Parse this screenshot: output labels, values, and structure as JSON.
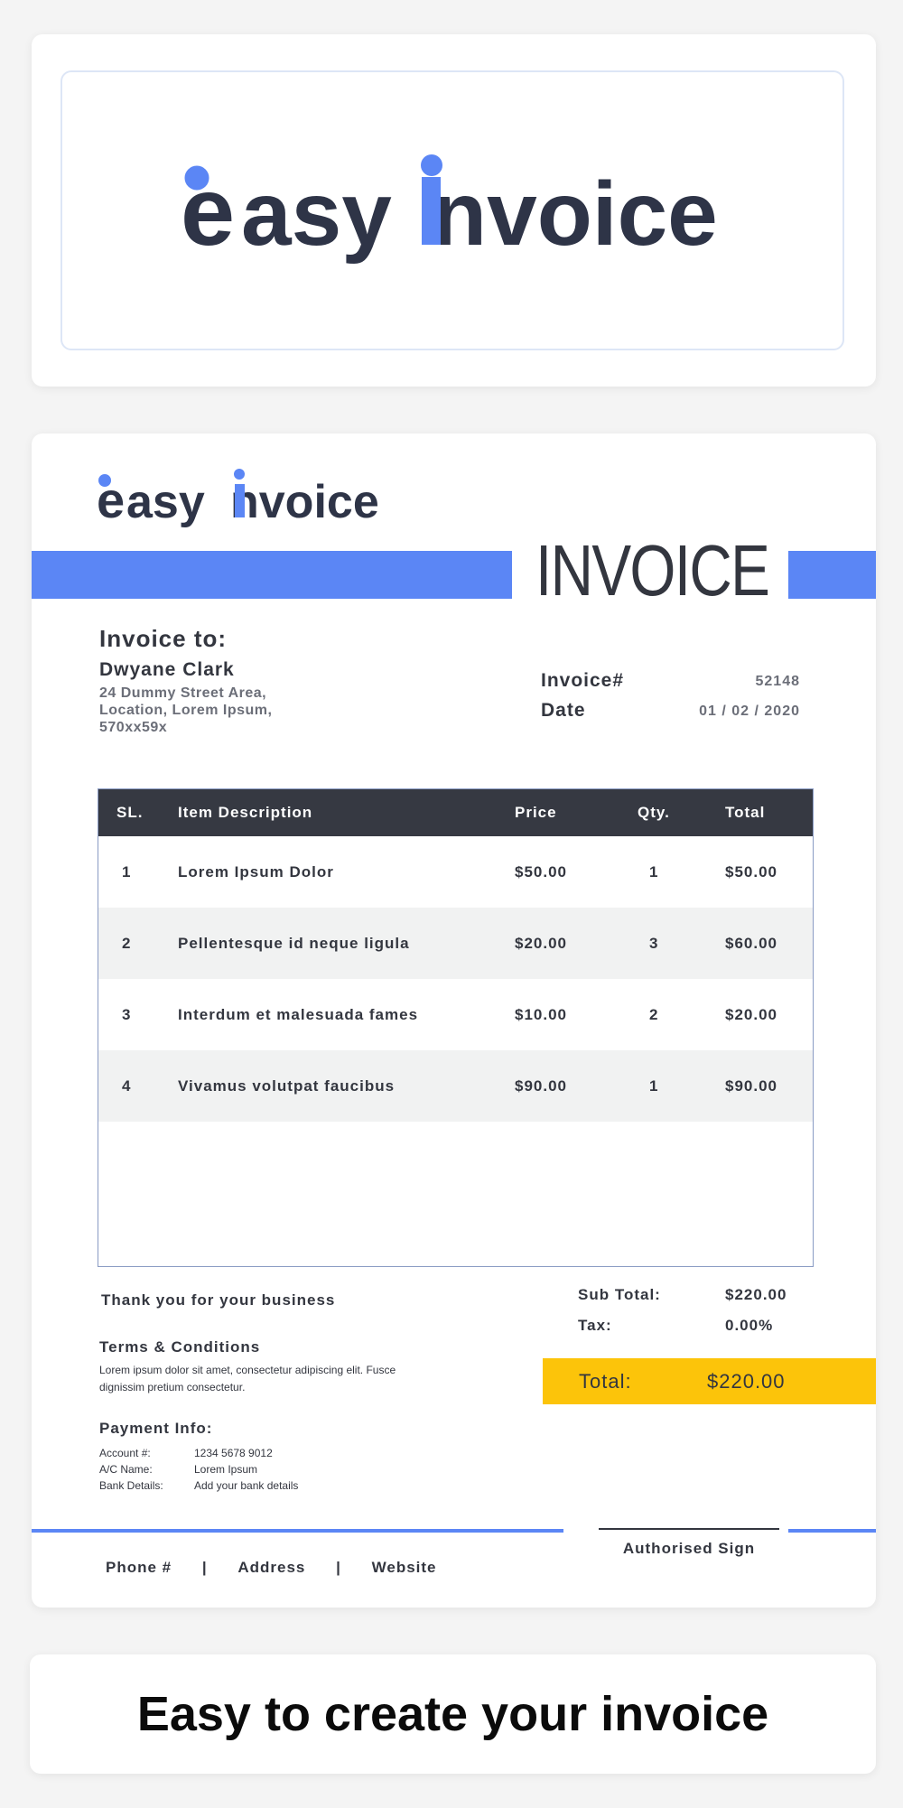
{
  "brand": {
    "logo_text": "easyinvoice",
    "navy": "#2e3447",
    "blue": "#5b86f5",
    "yellow": "#fcc40a"
  },
  "invoice": {
    "title": "INVOICE",
    "bill_to_heading": "Invoice to:",
    "client_name": "Dwyane Clark",
    "client_address": [
      "24 Dummy Street Area,",
      "Location, Lorem Ipsum,",
      "570xx59x"
    ],
    "number_label": "Invoice#",
    "number_value": "52148",
    "date_label": "Date",
    "date_value": "01 / 02 / 2020"
  },
  "table": {
    "headers": [
      "SL.",
      "Item Description",
      "Price",
      "Qty.",
      "Total"
    ],
    "rows": [
      {
        "sl": "1",
        "desc": "Lorem Ipsum Dolor",
        "price": "$50.00",
        "qty": "1",
        "total": "$50.00"
      },
      {
        "sl": "2",
        "desc": "Pellentesque id neque ligula",
        "price": "$20.00",
        "qty": "3",
        "total": "$60.00"
      },
      {
        "sl": "3",
        "desc": "Interdum et malesuada fames",
        "price": "$10.00",
        "qty": "2",
        "total": "$20.00"
      },
      {
        "sl": "4",
        "desc": "Vivamus volutpat faucibus",
        "price": "$90.00",
        "qty": "1",
        "total": "$90.00"
      }
    ]
  },
  "footer": {
    "thanks": "Thank you for your business",
    "terms_heading": "Terms & Conditions",
    "terms_text": "Lorem ipsum dolor sit amet, consectetur adipiscing elit. Fusce dignissim pretium consectetur.",
    "payment_heading": "Payment Info:",
    "payment": [
      {
        "key": "Account #:",
        "value": "1234 5678 9012"
      },
      {
        "key": "A/C Name:",
        "value": "Lorem Ipsum"
      },
      {
        "key": "Bank Details:",
        "value": "Add your bank details"
      }
    ],
    "subtotal_label": "Sub Total:",
    "subtotal_value": "$220.00",
    "tax_label": "Tax:",
    "tax_value": "0.00%",
    "total_label": "Total:",
    "total_value": "$220.00",
    "sign_label": "Authorised Sign",
    "contacts": [
      "Phone #",
      "Address",
      "Website"
    ],
    "separator": "|"
  },
  "tagline": "Easy to create your invoice"
}
